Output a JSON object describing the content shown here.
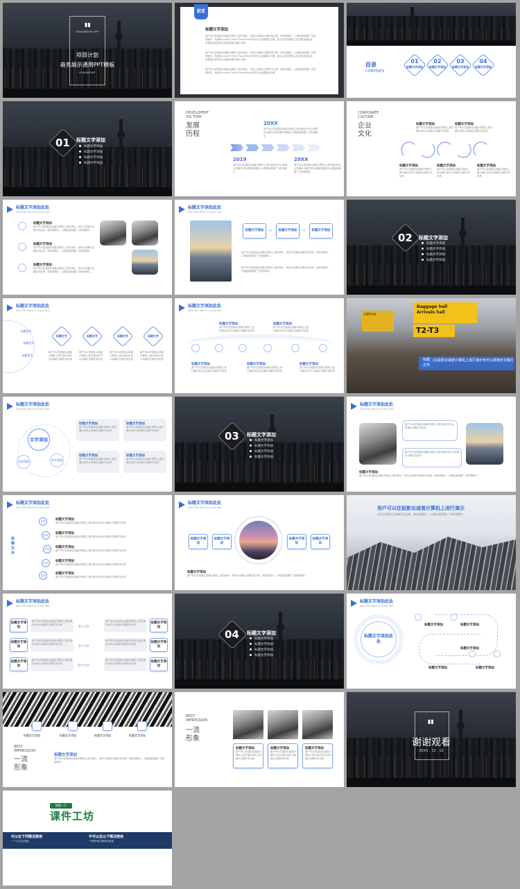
{
  "s1": {
    "logo_text": "DESIGNED BY LPPT",
    "line1": "项目计划",
    "line2": "商务展示通用PPT模板",
    "line3": "POWERPOINT"
  },
  "s2": {
    "tab": "前言",
    "title": "标题文字添加",
    "p1": "用户可以在投影仪或者计算机上进行演示，也可以将演示文稿打印出来，制作成胶片，以便应用到更广泛的领域中。利用Microsoft Office PowerPoint不仅可以创建演示文稿，还可以在互联网上召开面对面会议、远程会议或在网上给观众展示演示文稿。",
    "p2": "用户可以在投影仪或者计算机上进行演示，也可以将演示文稿打印出来，制作成胶片，以便应用到更广泛的领域中。利用Microsoft Office PowerPoint不仅可以创建演示文稿，还可以在互联网上召开面对面会议、远程会议或在网上给观众展示演示文稿。",
    "p3": "用户可以在投影仪或者计算机上进行演示，也可以将演示文稿打印出来，制作成胶片，以便应用到更广泛的领域中。利用Microsoft Office PowerPoint不仅可以创建演示文稿。"
  },
  "s3": {
    "title": "目录",
    "sub": "CONTENTS",
    "items": [
      {
        "num": "01",
        "label": "标题文字添加"
      },
      {
        "num": "02",
        "label": "标题文字添加"
      },
      {
        "num": "03",
        "label": "标题文字添加"
      },
      {
        "num": "04",
        "label": "标题文字添加"
      }
    ]
  },
  "sec": {
    "title": "标题文字添加",
    "item": "标题文字添加",
    "n1": "01",
    "n2": "02",
    "n3": "03",
    "n4": "04"
  },
  "s5": {
    "en1": "DEVELOPENT",
    "en2": "HIS TORY",
    "cn1": "发展",
    "cn2": "历程",
    "y1": "20XX",
    "y2": "2019",
    "y3": "20XX",
    "t": "用户可以在投影仪或者计算机上进行演示也可以将演示文稿打印出来制作成胶片以便应用到更广泛的领域中"
  },
  "s6": {
    "en1": "CORPORATE",
    "en2": "CULTURE",
    "cn1": "企业",
    "cn2": "文化",
    "label": "标题文字添加",
    "t": "用户可以在投影仪或者计算机上进行演示也可以将演示文稿打印出来"
  },
  "hdr": {
    "title": "标题文字添加此处",
    "sub": "Add Title Here Or Input Text"
  },
  "common": {
    "label": "标题文字添加",
    "short": "标题文字",
    "two_line": "标题文字添加",
    "body": "用户可以在投影仪或者计算机上进行演示，也可以将演示文稿打印出来，制作成胶片，以便应用到更广泛的领域中。",
    "body_short": "用户可以在投影仪或者计算机上进行演示也可以将演示文稿打印出来"
  },
  "s12": {
    "tag1": "标题",
    "tag2": "文字"
  },
  "s13": {
    "center": "文字添加",
    "side": "文字添加"
  },
  "s18": {
    "headline": "用户可以在投影仪或者计算机上进行演示",
    "sub": "也可以将演示文稿打印出来，制作成胶片，以便应用到更广泛的领域中"
  },
  "s21": {
    "center": "标题文字添加此处"
  },
  "s22": {
    "en1": "BEST",
    "en2": "IMPRESSION",
    "cn1": "一流",
    "cn2": "形象"
  },
  "s24": {
    "text": "谢谢观看",
    "date": "20XX . 12 . 12"
  },
  "s25": {
    "tag": "搜索一下",
    "brand": "课件工坊",
    "l1": "可以在下列情况使用",
    "l2": "不可以在以下情况使用",
    "l1b": "• 个人/企业用途",
    "l2b": "• 转售/转让等商业用途"
  },
  "colors": {
    "accent": "#3b6fd6",
    "dark": "#1d2126",
    "brand_green": "#1b7a3d",
    "navy": "#1e3a66"
  }
}
